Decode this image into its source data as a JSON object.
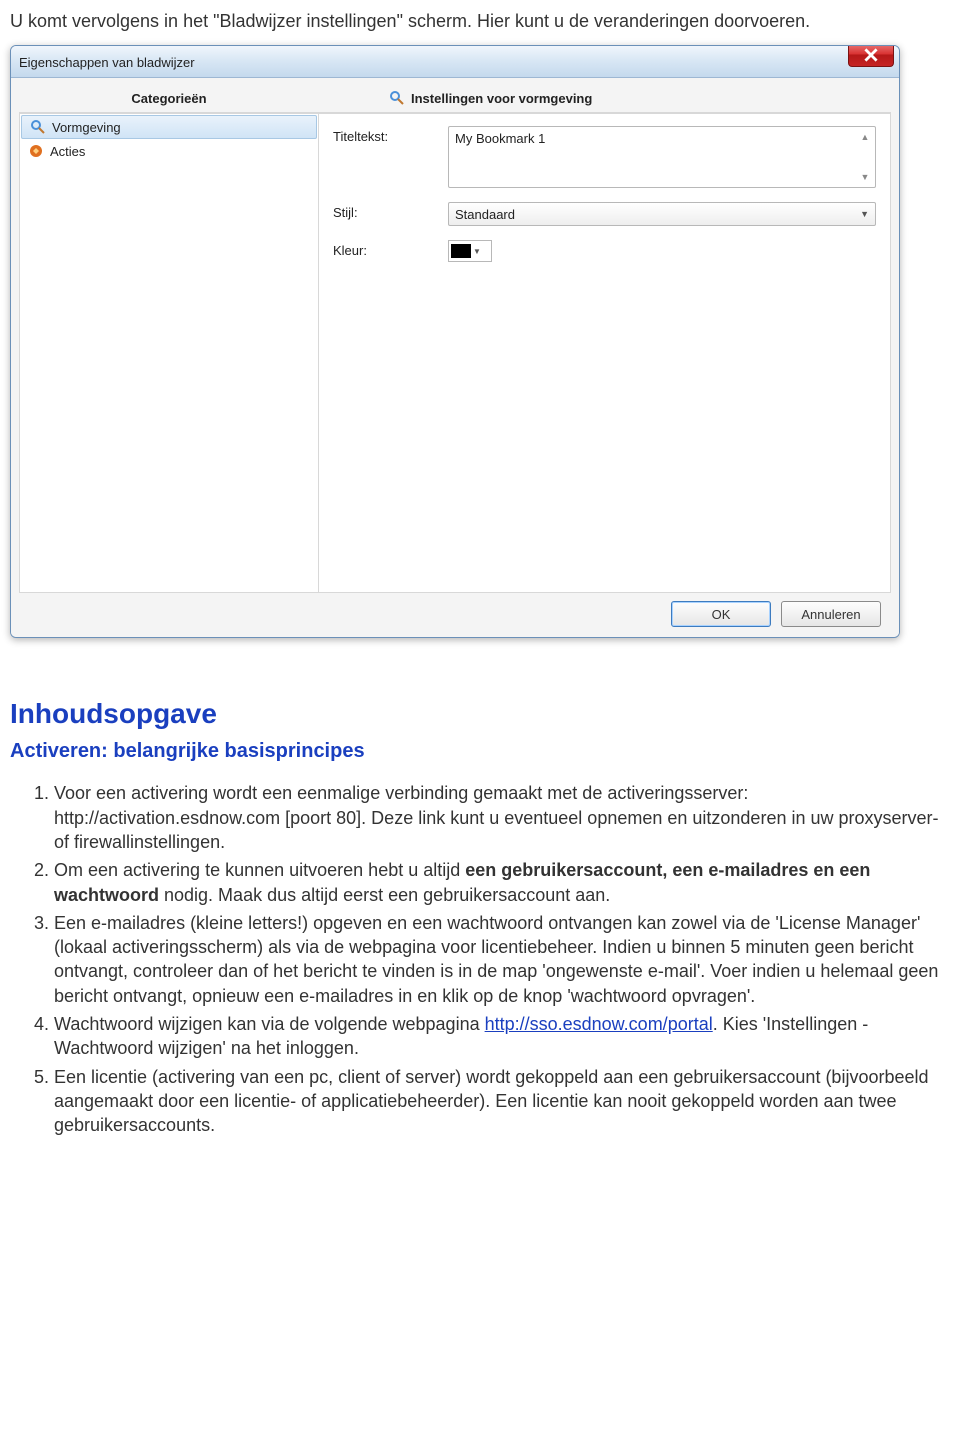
{
  "intro": "U komt vervolgens in het \"Bladwijzer instellingen\" scherm. Hier kunt u de veranderingen doorvoeren.",
  "dialog": {
    "title": "Eigenschappen van bladwijzer",
    "left_header": "Categorieën",
    "right_header": "Instellingen voor vormgeving",
    "categories": {
      "vormgeving": "Vormgeving",
      "acties": "Acties"
    },
    "form": {
      "titeltext_label": "Titeltekst:",
      "titeltext_value": "My Bookmark 1",
      "stijl_label": "Stijl:",
      "stijl_value": "Standaard",
      "kleur_label": "Kleur:"
    },
    "buttons": {
      "ok": "OK",
      "cancel": "Annuleren"
    }
  },
  "article": {
    "h1": "Inhoudsopgave",
    "h2": "Activeren: belangrijke basisprincipes",
    "items": {
      "i1a": "Voor een activering wordt een eenmalige verbinding gemaakt met de activeringsserver: http://activation.esdnow.com [poort 80]. Deze link kunt u eventueel opnemen en uitzonderen in uw proxyserver- of firewallinstellingen.",
      "i2a": "Om een activering te kunnen uitvoeren hebt u altijd ",
      "i2b": "een gebruikersaccount, een e-mailadres en een wachtwoord",
      "i2c": " nodig. Maak dus altijd eerst een gebruikersaccount aan.",
      "i3": "Een e-mailadres (kleine letters!) opgeven en een wachtwoord ontvangen kan zowel via de 'License Manager' (lokaal activeringsscherm) als via de webpagina voor licentiebeheer. Indien u binnen 5 minuten geen bericht ontvangt, controleer dan of het bericht te vinden is in de map 'ongewenste e-mail'. Voer indien u helemaal geen bericht ontvangt, opnieuw een e-mailadres in en klik op de knop 'wachtwoord opvragen'.",
      "i4a": "Wachtwoord wijzigen kan via de volgende webpagina ",
      "i4link": "http://sso.esdnow.com/portal",
      "i4b": ". Kies 'Instellingen - Wachtwoord wijzigen' na het inloggen.",
      "i5": "Een licentie (activering van een pc, client of server) wordt gekoppeld aan een gebruikersaccount (bijvoorbeeld aangemaakt door een licentie- of applicatiebeheerder). Een licentie kan nooit gekoppeld worden aan twee gebruikersaccounts."
    }
  }
}
